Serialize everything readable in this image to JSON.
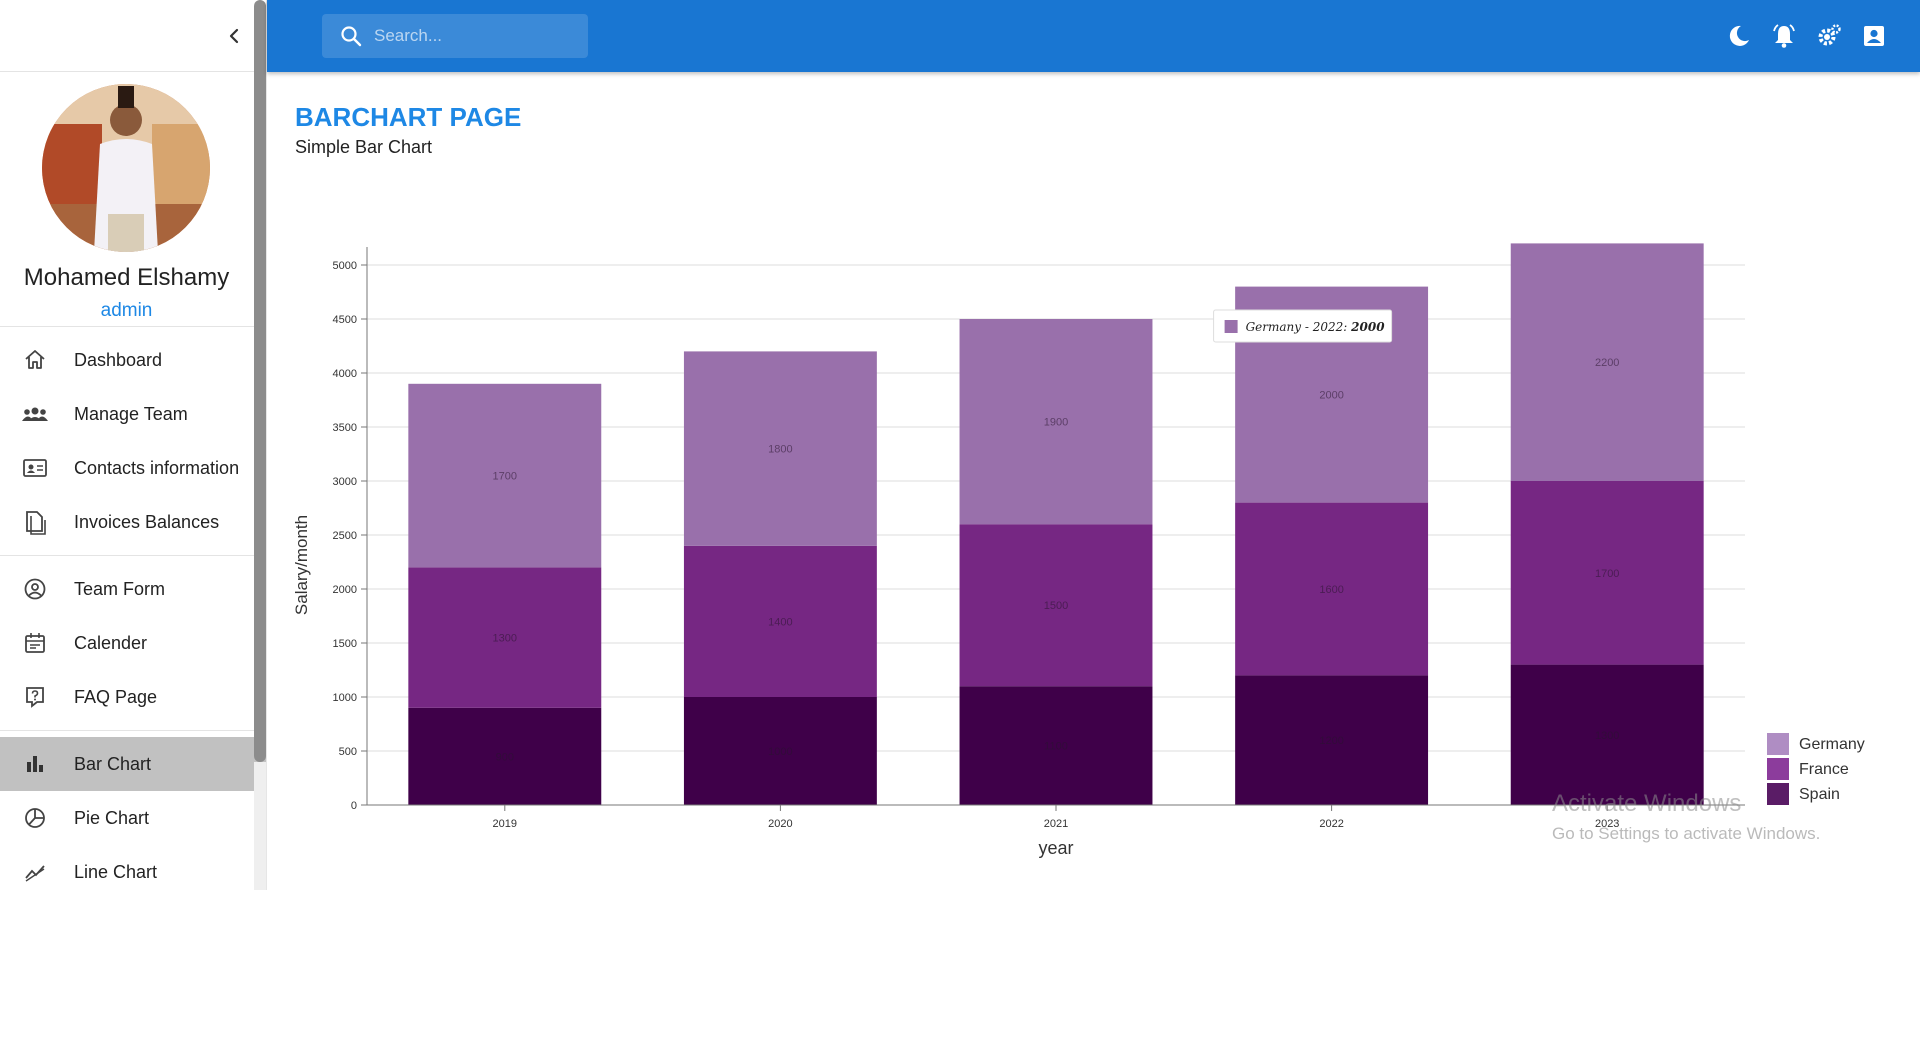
{
  "sidebar": {
    "user": {
      "name": "Mohamed Elshamy",
      "role": "admin"
    },
    "groups": [
      [
        {
          "label": "Dashboard",
          "icon": "home-icon"
        },
        {
          "label": "Manage Team",
          "icon": "people-icon"
        },
        {
          "label": "Contacts information",
          "icon": "contacts-icon"
        },
        {
          "label": "Invoices Balances",
          "icon": "invoices-icon"
        }
      ],
      [
        {
          "label": "Team Form",
          "icon": "person-outline-icon"
        },
        {
          "label": "Calender",
          "icon": "calendar-icon"
        },
        {
          "label": "FAQ Page",
          "icon": "help-icon"
        }
      ],
      [
        {
          "label": "Bar Chart",
          "icon": "bar-chart-icon",
          "active": true
        },
        {
          "label": "Pie Chart",
          "icon": "pie-chart-icon"
        },
        {
          "label": "Line Chart",
          "icon": "line-chart-icon"
        }
      ]
    ]
  },
  "header": {
    "search_placeholder": "Search...",
    "icons": [
      "dark-mode-icon",
      "notifications-icon",
      "settings-icon",
      "account-icon"
    ],
    "color": "#1976d2"
  },
  "main": {
    "title": "BARCHART PAGE",
    "subtitle": "Simple Bar Chart"
  },
  "chart_data": {
    "type": "bar",
    "stacked": true,
    "categories": [
      "2019",
      "2020",
      "2021",
      "2022",
      "2023"
    ],
    "series": [
      {
        "name": "Spain",
        "values": [
          900,
          1000,
          1100,
          1200,
          1300
        ],
        "color": "#3f0049"
      },
      {
        "name": "France",
        "values": [
          1300,
          1400,
          1500,
          1600,
          1700
        ],
        "color": "#762783"
      },
      {
        "name": "Germany",
        "values": [
          1700,
          1800,
          1900,
          2000,
          2200
        ],
        "color": "#9970ab"
      }
    ],
    "legend": {
      "position": "bottom-right",
      "items": [
        "Germany",
        "France",
        "Spain"
      ],
      "colors": [
        "#af8dc3",
        "#8c3c9c",
        "#5a1c66"
      ]
    },
    "xlabel": "year",
    "ylabel": "Salary/month",
    "yticks": [
      0,
      500,
      1000,
      1500,
      2000,
      2500,
      3000,
      3500,
      4000,
      4500,
      5000
    ],
    "ylim": [
      0,
      5000
    ],
    "grid": true,
    "tooltip": {
      "series": "Germany",
      "category": "2022",
      "prefix": "Germany - 2022: ",
      "value": "2000"
    }
  },
  "watermark": {
    "line1": "Activate Windows",
    "line2": "Go to Settings to activate Windows."
  }
}
